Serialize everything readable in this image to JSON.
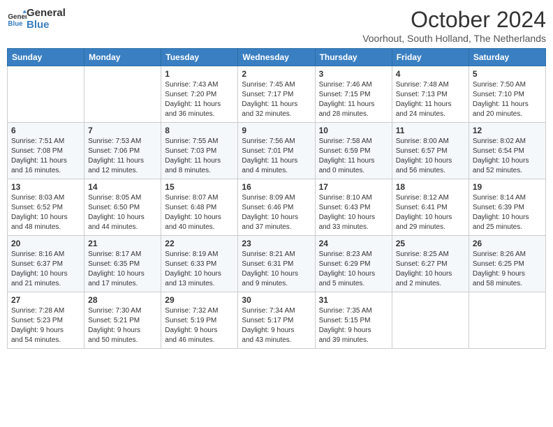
{
  "logo": {
    "text_general": "General",
    "text_blue": "Blue"
  },
  "title": "October 2024",
  "location": "Voorhout, South Holland, The Netherlands",
  "days_of_week": [
    "Sunday",
    "Monday",
    "Tuesday",
    "Wednesday",
    "Thursday",
    "Friday",
    "Saturday"
  ],
  "weeks": [
    [
      {
        "day": "",
        "content": ""
      },
      {
        "day": "",
        "content": ""
      },
      {
        "day": "1",
        "content": "Sunrise: 7:43 AM\nSunset: 7:20 PM\nDaylight: 11 hours\nand 36 minutes."
      },
      {
        "day": "2",
        "content": "Sunrise: 7:45 AM\nSunset: 7:17 PM\nDaylight: 11 hours\nand 32 minutes."
      },
      {
        "day": "3",
        "content": "Sunrise: 7:46 AM\nSunset: 7:15 PM\nDaylight: 11 hours\nand 28 minutes."
      },
      {
        "day": "4",
        "content": "Sunrise: 7:48 AM\nSunset: 7:13 PM\nDaylight: 11 hours\nand 24 minutes."
      },
      {
        "day": "5",
        "content": "Sunrise: 7:50 AM\nSunset: 7:10 PM\nDaylight: 11 hours\nand 20 minutes."
      }
    ],
    [
      {
        "day": "6",
        "content": "Sunrise: 7:51 AM\nSunset: 7:08 PM\nDaylight: 11 hours\nand 16 minutes."
      },
      {
        "day": "7",
        "content": "Sunrise: 7:53 AM\nSunset: 7:06 PM\nDaylight: 11 hours\nand 12 minutes."
      },
      {
        "day": "8",
        "content": "Sunrise: 7:55 AM\nSunset: 7:03 PM\nDaylight: 11 hours\nand 8 minutes."
      },
      {
        "day": "9",
        "content": "Sunrise: 7:56 AM\nSunset: 7:01 PM\nDaylight: 11 hours\nand 4 minutes."
      },
      {
        "day": "10",
        "content": "Sunrise: 7:58 AM\nSunset: 6:59 PM\nDaylight: 11 hours\nand 0 minutes."
      },
      {
        "day": "11",
        "content": "Sunrise: 8:00 AM\nSunset: 6:57 PM\nDaylight: 10 hours\nand 56 minutes."
      },
      {
        "day": "12",
        "content": "Sunrise: 8:02 AM\nSunset: 6:54 PM\nDaylight: 10 hours\nand 52 minutes."
      }
    ],
    [
      {
        "day": "13",
        "content": "Sunrise: 8:03 AM\nSunset: 6:52 PM\nDaylight: 10 hours\nand 48 minutes."
      },
      {
        "day": "14",
        "content": "Sunrise: 8:05 AM\nSunset: 6:50 PM\nDaylight: 10 hours\nand 44 minutes."
      },
      {
        "day": "15",
        "content": "Sunrise: 8:07 AM\nSunset: 6:48 PM\nDaylight: 10 hours\nand 40 minutes."
      },
      {
        "day": "16",
        "content": "Sunrise: 8:09 AM\nSunset: 6:46 PM\nDaylight: 10 hours\nand 37 minutes."
      },
      {
        "day": "17",
        "content": "Sunrise: 8:10 AM\nSunset: 6:43 PM\nDaylight: 10 hours\nand 33 minutes."
      },
      {
        "day": "18",
        "content": "Sunrise: 8:12 AM\nSunset: 6:41 PM\nDaylight: 10 hours\nand 29 minutes."
      },
      {
        "day": "19",
        "content": "Sunrise: 8:14 AM\nSunset: 6:39 PM\nDaylight: 10 hours\nand 25 minutes."
      }
    ],
    [
      {
        "day": "20",
        "content": "Sunrise: 8:16 AM\nSunset: 6:37 PM\nDaylight: 10 hours\nand 21 minutes."
      },
      {
        "day": "21",
        "content": "Sunrise: 8:17 AM\nSunset: 6:35 PM\nDaylight: 10 hours\nand 17 minutes."
      },
      {
        "day": "22",
        "content": "Sunrise: 8:19 AM\nSunset: 6:33 PM\nDaylight: 10 hours\nand 13 minutes."
      },
      {
        "day": "23",
        "content": "Sunrise: 8:21 AM\nSunset: 6:31 PM\nDaylight: 10 hours\nand 9 minutes."
      },
      {
        "day": "24",
        "content": "Sunrise: 8:23 AM\nSunset: 6:29 PM\nDaylight: 10 hours\nand 5 minutes."
      },
      {
        "day": "25",
        "content": "Sunrise: 8:25 AM\nSunset: 6:27 PM\nDaylight: 10 hours\nand 2 minutes."
      },
      {
        "day": "26",
        "content": "Sunrise: 8:26 AM\nSunset: 6:25 PM\nDaylight: 9 hours\nand 58 minutes."
      }
    ],
    [
      {
        "day": "27",
        "content": "Sunrise: 7:28 AM\nSunset: 5:23 PM\nDaylight: 9 hours\nand 54 minutes."
      },
      {
        "day": "28",
        "content": "Sunrise: 7:30 AM\nSunset: 5:21 PM\nDaylight: 9 hours\nand 50 minutes."
      },
      {
        "day": "29",
        "content": "Sunrise: 7:32 AM\nSunset: 5:19 PM\nDaylight: 9 hours\nand 46 minutes."
      },
      {
        "day": "30",
        "content": "Sunrise: 7:34 AM\nSunset: 5:17 PM\nDaylight: 9 hours\nand 43 minutes."
      },
      {
        "day": "31",
        "content": "Sunrise: 7:35 AM\nSunset: 5:15 PM\nDaylight: 9 hours\nand 39 minutes."
      },
      {
        "day": "",
        "content": ""
      },
      {
        "day": "",
        "content": ""
      }
    ]
  ]
}
